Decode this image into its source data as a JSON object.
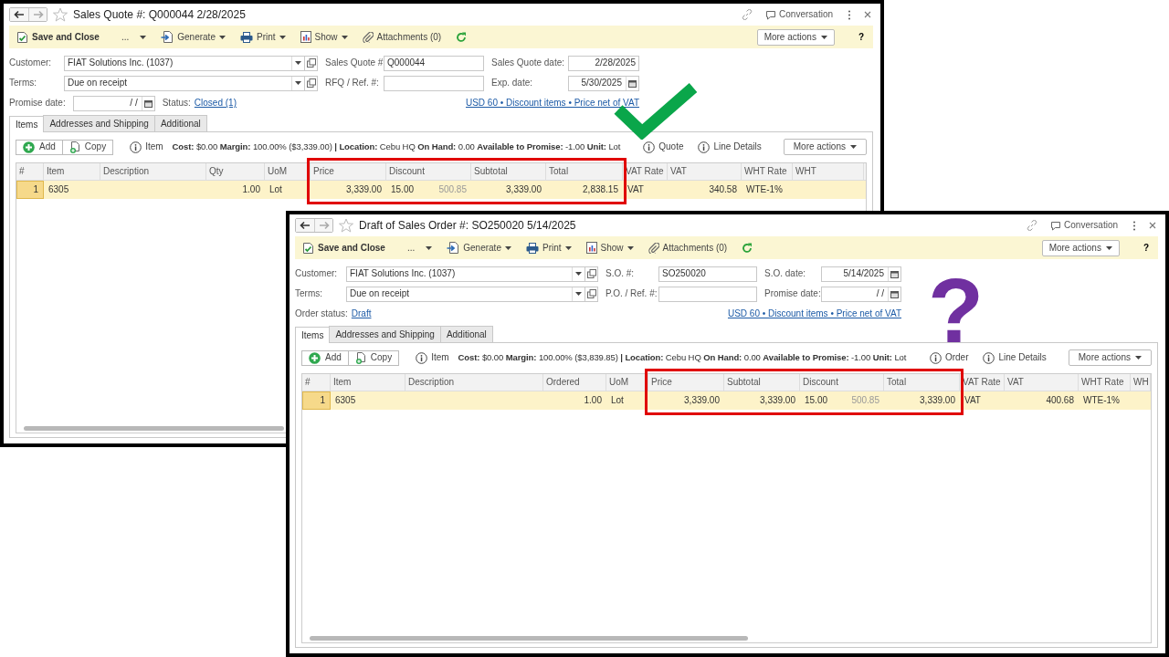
{
  "windows": [
    {
      "title": "Sales Quote #: Q000044 2/28/2025",
      "conversation": "Conversation",
      "toolbar": [
        {
          "kind": "save",
          "label": "Save and Close"
        },
        {
          "kind": "ellipsis",
          "label": "..."
        },
        {
          "kind": "generate",
          "label": "Generate"
        },
        {
          "kind": "print",
          "label": "Print"
        },
        {
          "kind": "show",
          "label": "Show"
        },
        {
          "kind": "attachments",
          "label": "Attachments (0)"
        },
        {
          "kind": "refresh"
        }
      ],
      "more_actions": "More actions",
      "help": "?",
      "form": {
        "rows": [
          [
            {
              "label": "Customer:",
              "kind": "combo",
              "value": "FIAT Solutions Inc. (1037)"
            },
            {
              "label": "Sales Quote #:",
              "kind": "text",
              "value": "Q000044"
            },
            {
              "label": "Sales Quote date:",
              "kind": "date-plain",
              "value": "2/28/2025"
            }
          ],
          [
            {
              "label": "Terms:",
              "kind": "combo",
              "value": "Due on receipt"
            },
            {
              "label": "RFQ / Ref. #:",
              "kind": "text"
            },
            {
              "label": "Exp. date:",
              "kind": "date",
              "value": "5/30/2025"
            }
          ]
        ],
        "status_line": [
          {
            "kind": "date",
            "label": "Promise date:",
            "value": "/ /"
          },
          {
            "kind": "link",
            "label": "Status:",
            "value": "Closed (1)"
          },
          {
            "kind": "summary",
            "value": "USD 60 • Discount items • Price net of VAT"
          }
        ]
      },
      "tabs": [
        {
          "label": "Items",
          "selected": true
        },
        {
          "label": "Addresses and Shipping",
          "selected": false
        },
        {
          "label": "Additional",
          "selected": false
        }
      ],
      "grid_toolbar": {
        "add": "Add",
        "copy": "Copy",
        "info_label": "Item",
        "info": "**Cost:** $0.00 **Margin:** 100.00% ($3,339.00) **| Location:** Cebu HQ **On Hand:** 0.00 **Available to Promise:** -1.00 **Unit:** Lot",
        "links": [
          "Quote",
          "Line Details"
        ],
        "more_actions": "More actions"
      },
      "table": {
        "columns": [
          {
            "label": "#",
            "kind": "index",
            "highlighted": false
          },
          {
            "label": "Item",
            "kind": "text",
            "highlighted": false
          },
          {
            "label": "Description",
            "kind": "text",
            "highlighted": false
          },
          {
            "label": "Qty",
            "kind": "number",
            "highlighted": false
          },
          {
            "label": "UoM",
            "kind": "text",
            "highlighted": false
          },
          {
            "label": "Price",
            "kind": "number",
            "highlighted": true
          },
          {
            "label": "Discount",
            "kind": "discount",
            "highlighted": true
          },
          {
            "label": "Subtotal",
            "kind": "number",
            "highlighted": true
          },
          {
            "label": "Total",
            "kind": "number",
            "highlighted": true
          },
          {
            "label": "VAT Rate",
            "kind": "text",
            "highlighted": false
          },
          {
            "label": "VAT",
            "kind": "number",
            "highlighted": false
          },
          {
            "label": "WHT Rate",
            "kind": "text",
            "highlighted": false
          },
          {
            "label": "WHT",
            "kind": "text",
            "highlighted": false
          }
        ],
        "rows": [
          {
            "selected": true,
            "cells": [
              "1",
              "6305",
              null,
              "1.00",
              "Lot",
              "3,339.00",
              {
                "percent": "15.00",
                "amount": "500.85"
              },
              "3,339.00",
              "2,838.15",
              "VAT",
              "340.58",
              "WTE-1%",
              null
            ]
          }
        ]
      }
    },
    {
      "title": "Draft of Sales Order #: SO250020 5/14/2025",
      "conversation": "Conversation",
      "toolbar": [
        {
          "kind": "save",
          "label": "Save and Close"
        },
        {
          "kind": "ellipsis",
          "label": "..."
        },
        {
          "kind": "generate",
          "label": "Generate"
        },
        {
          "kind": "print",
          "label": "Print"
        },
        {
          "kind": "show",
          "label": "Show"
        },
        {
          "kind": "attachments",
          "label": "Attachments (0)"
        },
        {
          "kind": "refresh"
        }
      ],
      "more_actions": "More actions",
      "help": "?",
      "form": {
        "rows": [
          [
            {
              "label": "Customer:",
              "kind": "combo",
              "value": "FIAT Solutions Inc. (1037)"
            },
            {
              "label": "S.O. #:",
              "kind": "text",
              "value": "SO250020"
            },
            {
              "label": "S.O. date:",
              "kind": "date",
              "value": "5/14/2025"
            }
          ],
          [
            {
              "label": "Terms:",
              "kind": "combo",
              "value": "Due on receipt"
            },
            {
              "label": "P.O. / Ref. #:",
              "kind": "text"
            },
            {
              "label": "Promise date:",
              "kind": "date",
              "value": "/ /"
            }
          ]
        ],
        "status_line": [
          {
            "kind": "link",
            "label": "Order status:",
            "value": "Draft"
          },
          {
            "kind": "summary",
            "value": "USD 60 • Discount items • Price net of VAT"
          }
        ]
      },
      "tabs": [
        {
          "label": "Items",
          "selected": true
        },
        {
          "label": "Addresses and Shipping",
          "selected": false
        },
        {
          "label": "Additional",
          "selected": false
        }
      ],
      "grid_toolbar": {
        "add": "Add",
        "copy": "Copy",
        "info_label": "Item",
        "info": "**Cost:** $0.00 **Margin:** 100.00% ($3,839.85) **| Location:** Cebu HQ **On Hand:** 0.00 **Available to Promise:** -1.00 **Unit:** Lot",
        "links": [
          "Order",
          "Line Details"
        ],
        "more_actions": "More actions"
      },
      "table": {
        "columns": [
          {
            "label": "#",
            "kind": "index",
            "highlighted": false
          },
          {
            "label": "Item",
            "kind": "text",
            "highlighted": false
          },
          {
            "label": "Description",
            "kind": "text",
            "highlighted": false
          },
          {
            "label": "Ordered",
            "kind": "number",
            "highlighted": false
          },
          {
            "label": "UoM",
            "kind": "text",
            "highlighted": false
          },
          {
            "label": "Price",
            "kind": "number",
            "highlighted": true
          },
          {
            "label": "Subtotal",
            "kind": "number",
            "highlighted": true
          },
          {
            "label": "Discount",
            "kind": "discount",
            "highlighted": true
          },
          {
            "label": "Total",
            "kind": "number",
            "highlighted": true
          },
          {
            "label": "VAT Rate",
            "kind": "text",
            "highlighted": false
          },
          {
            "label": "VAT",
            "kind": "number",
            "highlighted": false
          },
          {
            "label": "WHT Rate",
            "kind": "text",
            "highlighted": false
          },
          {
            "label": "WH",
            "kind": "text",
            "highlighted": false
          }
        ],
        "rows": [
          {
            "selected": true,
            "cells": [
              "1",
              "6305",
              null,
              "1.00",
              "Lot",
              "3,339.00",
              "3,339.00",
              {
                "percent": "15.00",
                "amount": "500.85"
              },
              "3,339.00",
              "VAT",
              "400.68",
              "WTE-1%",
              null
            ]
          }
        ]
      }
    }
  ],
  "annotations": [
    {
      "kind": "check",
      "color": "#0aa64a"
    },
    {
      "kind": "question",
      "text": "?",
      "color": "#7030a0"
    }
  ]
}
